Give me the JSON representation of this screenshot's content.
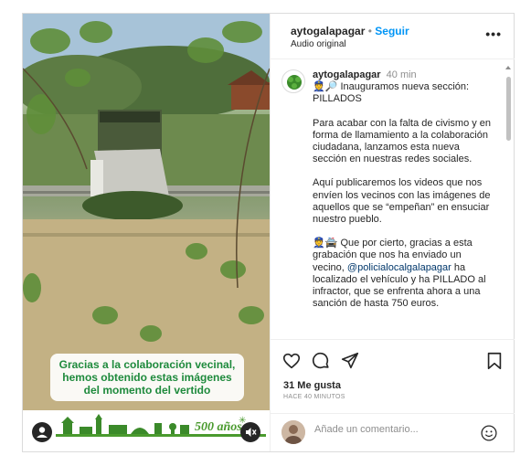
{
  "media": {
    "caption_lines": [
      "Gracias a la colaboración vecinal,",
      "hemos obtenido estas imágenes",
      "del momento del vertido"
    ],
    "logo_text": "500 años"
  },
  "header": {
    "username": "aytogalapagar",
    "separator": "•",
    "follow_label": "Seguir",
    "subtitle": "Audio original",
    "more_label": "•••"
  },
  "caption": {
    "username": "aytogalapagar",
    "time": "40 min",
    "lines": {
      "l1": "👮🔎 Inauguramos nueva sección: PILLADOS",
      "l2": "Para acabar con la falta de civismo y en forma de llamamiento a la colaboración ciudadana, lanzamos esta nueva sección en nuestras redes sociales.",
      "l3": "Aquí publicaremos los videos que nos envíen los vecinos con las imágenes de aquellos que se “empeñan” en ensuciar nuestro pueblo.",
      "l4_pre": "👮🚔 Que por cierto, gracias a esta grabación que nos ha enviado un vecino, ",
      "l4_mention": "@policialocalgalapagar",
      "l4_post": " ha localizado el vehículo y ha PILLADO al infractor, que se enfrenta ahora a una sanción de hasta 750 euros."
    }
  },
  "actions": {
    "icons": [
      "heart-icon",
      "comment-icon",
      "share-icon",
      "bookmark-icon"
    ],
    "likes": "31 Me gusta",
    "ago": "HACE 40 MINUTOS"
  },
  "comment": {
    "placeholder": "Añade un comentario...",
    "emoji_icon": "smiley-icon"
  },
  "colors": {
    "follow": "#0095f6",
    "caption_green": "#1e8a3c",
    "mention": "#00376b"
  }
}
